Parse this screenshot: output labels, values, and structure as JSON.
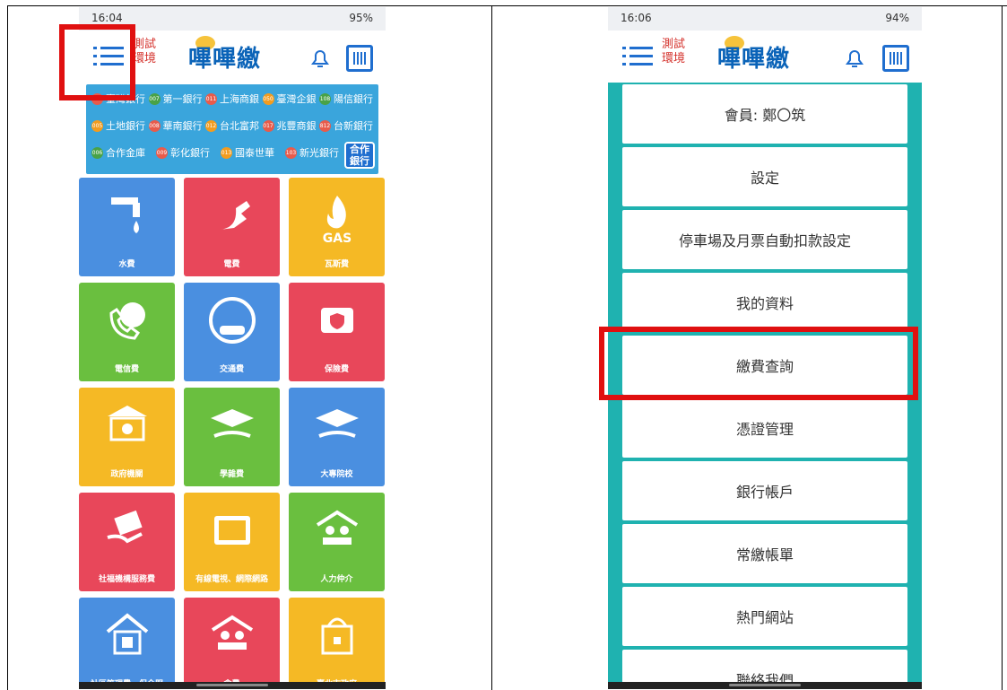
{
  "left_phone": {
    "status_time": "16:04",
    "status_right": "95%",
    "env_label": [
      "測試",
      "環境"
    ],
    "logo_text": "嗶嗶繳",
    "banks": [
      [
        {
          "code": "004",
          "name": "臺灣銀行",
          "color": "#e85b4b"
        },
        {
          "code": "007",
          "name": "第一銀行",
          "color": "#49a247"
        },
        {
          "code": "011",
          "name": "上海商銀",
          "color": "#e85b4b"
        },
        {
          "code": "050",
          "name": "臺灣企銀",
          "color": "#f29c1f"
        },
        {
          "code": "108",
          "name": "陽信銀行",
          "color": "#49a247"
        }
      ],
      [
        {
          "code": "005",
          "name": "土地銀行",
          "color": "#f29c1f"
        },
        {
          "code": "008",
          "name": "華南銀行",
          "color": "#e85b4b"
        },
        {
          "code": "012",
          "name": "台北富邦",
          "color": "#f29c1f"
        },
        {
          "code": "017",
          "name": "兆豐商銀",
          "color": "#e85b4b"
        },
        {
          "code": "812",
          "name": "台新銀行",
          "color": "#e85b4b"
        }
      ],
      [
        {
          "code": "006",
          "name": "合作金庫",
          "color": "#49a247"
        },
        {
          "code": "009",
          "name": "彰化銀行",
          "color": "#e85b4b"
        },
        {
          "code": "013",
          "name": "國泰世華",
          "color": "#f29c1f"
        },
        {
          "code": "103",
          "name": "新光銀行",
          "color": "#e85b4b"
        }
      ]
    ],
    "partner_label": "合作銀行",
    "tiles": [
      {
        "label": "水費",
        "color": "#4a8fe0",
        "icon": "water-tap-icon"
      },
      {
        "label": "電費",
        "color": "#e8475a",
        "icon": "electric-plug-icon"
      },
      {
        "label": "瓦斯費",
        "color": "#f5b925",
        "icon": "gas-flame-icon"
      },
      {
        "label": "電信費",
        "color": "#6abf3f",
        "icon": "phone-icon"
      },
      {
        "label": "交通費",
        "color": "#4a8fe0",
        "icon": "car-icon"
      },
      {
        "label": "保險費",
        "color": "#e8475a",
        "icon": "insurance-kit-icon"
      },
      {
        "label": "政府機關",
        "color": "#f5b925",
        "icon": "government-building-icon"
      },
      {
        "label": "學雜費",
        "color": "#6abf3f",
        "icon": "graduation-cap-icon"
      },
      {
        "label": "大專院校",
        "color": "#4a8fe0",
        "icon": "university-cap-icon"
      },
      {
        "label": "社福機構服務費",
        "color": "#e8475a",
        "icon": "money-hand-icon"
      },
      {
        "label": "有線電視、網際網路",
        "color": "#f5b925",
        "icon": "tv-icon"
      },
      {
        "label": "人力仲介",
        "color": "#6abf3f",
        "icon": "people-house-icon"
      },
      {
        "label": "社區管理費、保全服",
        "color": "#4a8fe0",
        "icon": "house-icon"
      },
      {
        "label": "會費",
        "color": "#e8475a",
        "icon": "people-group-icon"
      },
      {
        "label": "臺北市政府",
        "color": "#f5b925",
        "icon": "city-hall-icon"
      }
    ]
  },
  "right_phone": {
    "status_time": "16:06",
    "status_right": "94%",
    "env_label": [
      "測試",
      "環境"
    ],
    "logo_text": "嗶嗶繳",
    "menu": [
      "會員: 鄭〇筑",
      "設定",
      "停車場及月票自動扣款設定",
      "我的資料",
      "繳費查詢",
      "憑證管理",
      "銀行帳戶",
      "常繳帳單",
      "熱門網站",
      "聯絡我們"
    ],
    "highlighted": "繳費查詢"
  },
  "colors": {
    "highlight": "#e01010",
    "menu_bg": "#1fb2b0",
    "brand_blue": "#0a63b8"
  }
}
